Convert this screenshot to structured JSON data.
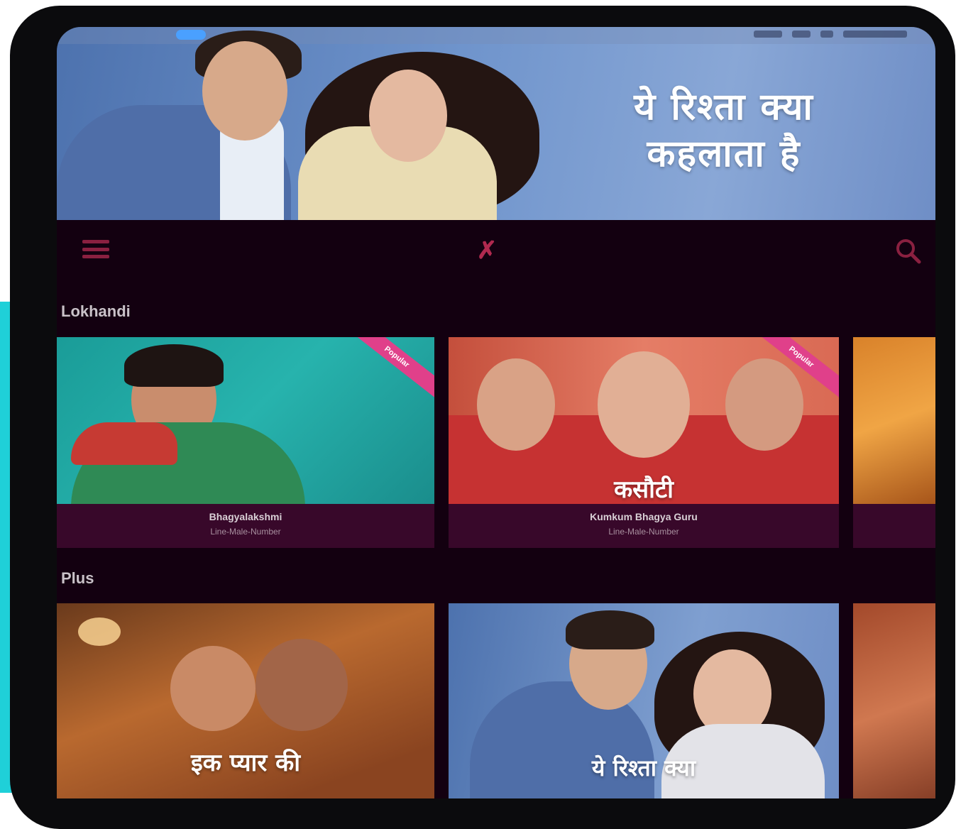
{
  "hero": {
    "title_line1": "ये रिश्ता क्या",
    "title_line2": "कहलाता है"
  },
  "nav": {
    "menu_icon": "hamburger-menu-icon",
    "logo_icon": "app-logo-icon",
    "logo_glyph": "✗",
    "search_icon": "search-icon"
  },
  "sections": [
    {
      "title": "Lokhandi",
      "cards": [
        {
          "title": "Bhagyalakshmi",
          "subtitle": "Line-Male-Number",
          "badge": "Popular",
          "poster_text": ""
        },
        {
          "title": "Kumkum Bhagya Guru",
          "subtitle": "Line-Male-Number",
          "badge": "Popular",
          "poster_text": "कसौटी"
        },
        {
          "title": "",
          "subtitle": "",
          "badge": "",
          "poster_text": ""
        }
      ]
    },
    {
      "title": "Plus",
      "cards": [
        {
          "title": "",
          "subtitle": "",
          "badge": "",
          "poster_text": "इक प्यार की"
        },
        {
          "title": "",
          "subtitle": "",
          "badge": "",
          "poster_text": "ये रिश्ता क्या"
        },
        {
          "title": "",
          "subtitle": "",
          "badge": "",
          "poster_text": ""
        }
      ]
    }
  ],
  "colors": {
    "background": "#130010",
    "card_info": "#38082a",
    "accent": "#b0294f",
    "ribbon": "#e0408a",
    "left_accent": "#1fd0d8"
  }
}
